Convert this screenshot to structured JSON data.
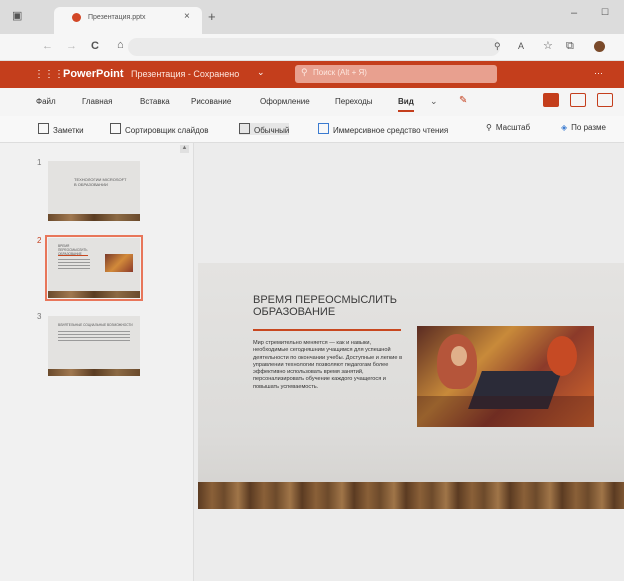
{
  "browser": {
    "tab_title": "Презентация.pptx",
    "close": "×",
    "new_tab": "+",
    "reload": "C",
    "home": "⌂",
    "minimize": "–",
    "maximize": "☐"
  },
  "ppt": {
    "app_name": "PowerPoint",
    "doc_title": "Презентация - Сохранено",
    "dropdown": "⌄",
    "search_placeholder": "Поиск (Alt + Я)",
    "more": "···"
  },
  "menu": [
    "Файл",
    "Главная",
    "Вставка",
    "Рисование",
    "Оформление",
    "Переходы",
    "Вид"
  ],
  "toolbar": [
    "Заметки",
    "Сортировщик слайдов",
    "Обычный",
    "Иммерсивное средство чтения",
    "Масштаб",
    "По разме"
  ],
  "thumbs": [
    {
      "num": "1",
      "title": "ТЕХНОЛОГИИ MICROSOFT В ОБРАЗОВАНИИ"
    },
    {
      "num": "2",
      "title": "ВРЕМЯ ПЕРЕОСМЫСЛИТЬ ОБРАЗОВАНИЕ"
    },
    {
      "num": "3",
      "title": "ВЛИЯТЕЛЬНЫЕ СОЦИАЛЬНЫЕ ВОЗМОЖНОСТИ"
    }
  ],
  "slide": {
    "title": "ВРЕМЯ ПЕРЕОСМЫСЛИТЬ ОБРАЗОВАНИЕ",
    "body": "Мир стремительно меняется — как и навыки, необходимые сегодняшним учащимся для успешной деятельности по окончании учебы. Доступные и легкие в управлении технологии позволяют педагогам более эффективно использовать время занятий, персонализировать обучение каждого учащегося и повышать успеваемость."
  },
  "colors": {
    "accent": "#c43e1c",
    "slide_line": "#c8471f"
  }
}
